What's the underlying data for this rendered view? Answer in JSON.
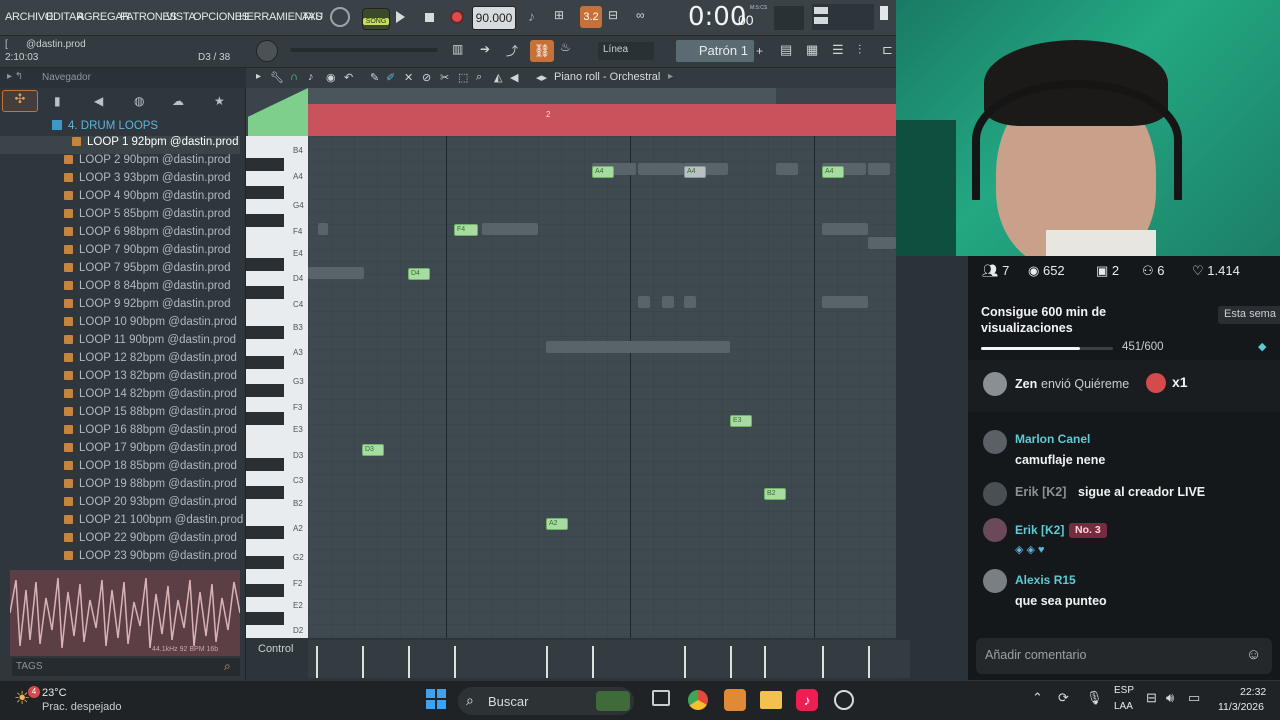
{
  "menu": [
    "ARCHIVO",
    "EDITAR",
    "AGREGAR",
    "PATRONES",
    "VISTA",
    "OPCIONES",
    "HERRAMIENTAS",
    "AYU"
  ],
  "transport": {
    "song_label": "SONG",
    "tempo": "90.000",
    "time": "0:00",
    "time_small": "00",
    "time_unit": "M:S:CS",
    "snap_value": "3.2"
  },
  "hint": {
    "user": "@dastin.prod",
    "time": "2:10:03",
    "position": "D3 / 38",
    "line_mode": "Línea",
    "pattern": "Patrón 1"
  },
  "browser": {
    "title": "Navegador",
    "folder": "4. DRUM LOOPS",
    "items": [
      "LOOP 1 92bpm @dastin.prod",
      "LOOP 2 90bpm @dastin.prod",
      "LOOP 3 93bpm @dastin.prod",
      "LOOP 4 90bpm @dastin.prod",
      "LOOP 5 85bpm @dastin.prod",
      "LOOP 6 98bpm @dastin.prod",
      "LOOP 7 90bpm @dastin.prod",
      "LOOP 7 95bpm @dastin.prod",
      "LOOP 8 84bpm @dastin.prod",
      "LOOP 9 92bpm @dastin.prod",
      "LOOP 10 90bpm @dastin.prod",
      "LOOP 11 90bpm @dastin.prod",
      "LOOP 12 82bpm @dastin.prod",
      "LOOP 13 82bpm @dastin.prod",
      "LOOP 14 82bpm @dastin.prod",
      "LOOP 15 88bpm @dastin.prod",
      "LOOP 16 88bpm @dastin.prod",
      "LOOP 17 90bpm @dastin.prod",
      "LOOP 18 85bpm @dastin.prod",
      "LOOP 19 88bpm @dastin.prod",
      "LOOP 20 93bpm @dastin.prod",
      "LOOP 21 100bpm @dastin.prod",
      "LOOP 22 90bpm @dastin.prod",
      "LOOP 23 90bpm @dastin.prod"
    ],
    "tags_label": "TAGS",
    "waveform_info": "44.1kHz 92 BPM 16b"
  },
  "pianoroll": {
    "title": "Piano roll - Orchestral",
    "bar_marker": "2",
    "key_labels": [
      "B4",
      "A4",
      "G4",
      "F4",
      "E4",
      "D4",
      "C4",
      "B3",
      "A3",
      "G3",
      "F3",
      "E3",
      "D3",
      "C3",
      "B2",
      "A2",
      "G2",
      "F2",
      "E2",
      "D2"
    ],
    "notes": [
      "A4",
      "A4",
      "F4",
      "D4",
      "D3",
      "A2",
      "E3",
      "B2"
    ],
    "control_label": "Control"
  },
  "live": {
    "stats": {
      "viewers": "7",
      "views": "652",
      "gifts": "2",
      "new_followers": "6",
      "likes": "1.414"
    },
    "goal": {
      "title": "Consigue 600 min de visualizaciones",
      "progress": "451/600",
      "progress_fraction": 0.752,
      "button": "Esta sema"
    },
    "gift": {
      "user": "Zen",
      "verb": "envió Quiéreme",
      "count": "x1"
    },
    "messages": [
      {
        "name": "Marlon Canel",
        "text": "camuflaje nene"
      },
      {
        "name": "Erik [K2]",
        "text": "sigue al creador LIVE"
      },
      {
        "name": "Erik [K2]",
        "badge": "No. 3",
        "text": ""
      },
      {
        "name": "Alexis R15",
        "text": "que sea punteo"
      }
    ],
    "comment_placeholder": "Añadir comentario"
  },
  "taskbar": {
    "temp": "23°C",
    "weather": "Prac. despejado",
    "search": "Buscar",
    "lang": "ESP",
    "lang2": "LAA",
    "time": "22:32",
    "date": "11/3/2026",
    "badge": "4"
  }
}
